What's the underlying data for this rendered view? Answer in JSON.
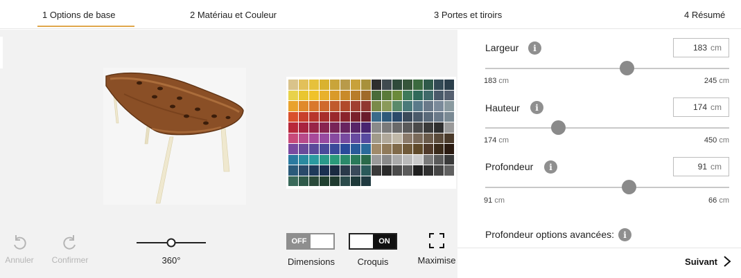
{
  "tabs": [
    {
      "label": "1 Options de base"
    },
    {
      "label": "2 Matériau et Couleur"
    },
    {
      "label": "3 Portes et tiroirs"
    },
    {
      "label": "4 Résumé"
    }
  ],
  "colors": {
    "accent": "#e0a64a",
    "thumb": "#8a8a8a",
    "muted_text": "#b5b5b5"
  },
  "viewer": {
    "undo_label": "Annuler",
    "redo_label": "Confirmer",
    "rotate_label": "360°",
    "rotate_value": 0.5,
    "dimensions": {
      "label": "Dimensions",
      "state": "OFF"
    },
    "croquis": {
      "label": "Croquis",
      "state": "ON"
    },
    "maximise_label": "Maximise"
  },
  "params": {
    "largeur": {
      "label": "Largeur",
      "value": "183",
      "unit": "cm",
      "min": "183",
      "max": "245",
      "fraction": 0.58
    },
    "hauteur": {
      "label": "Hauteur",
      "value": "174",
      "unit": "cm",
      "min": "174",
      "max": "450",
      "fraction": 0.3
    },
    "profondeur": {
      "label": "Profondeur",
      "value": "91",
      "unit": "cm",
      "min": "91",
      "max": "66",
      "fraction": 0.59
    },
    "advanced_label": "Profondeur options avancées:"
  },
  "footer": {
    "next_label": "Suivant"
  }
}
